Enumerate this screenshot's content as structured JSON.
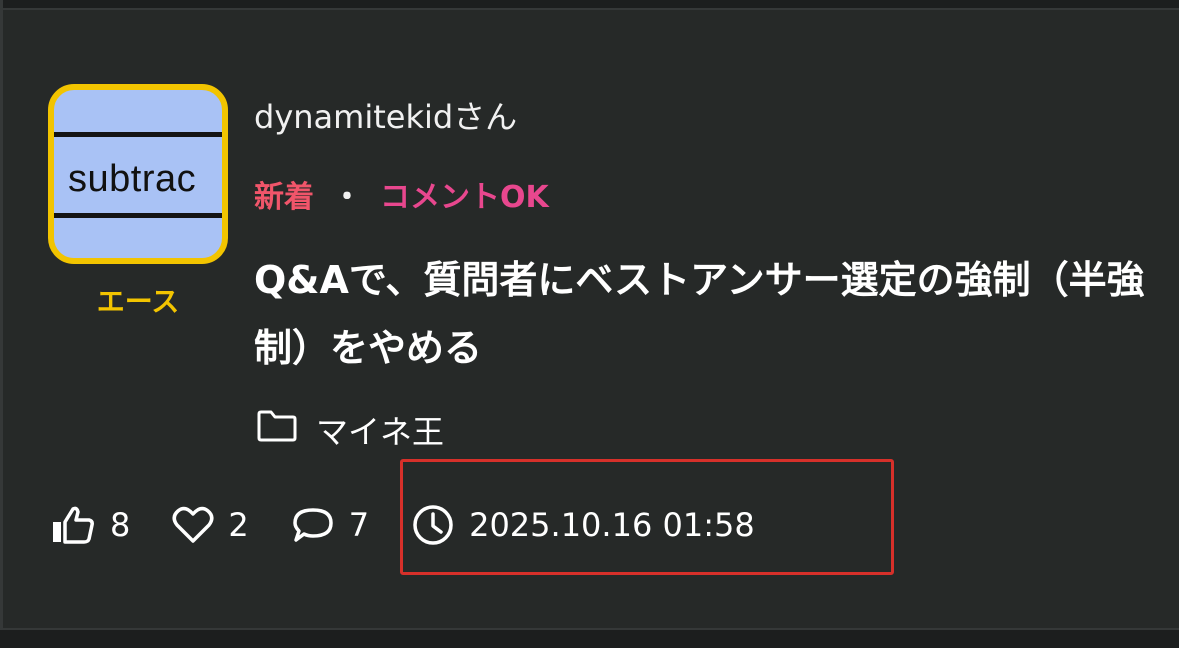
{
  "user": {
    "avatar_text": "subtrac",
    "rank": "エース",
    "name": "dynamitekidさん"
  },
  "tags": {
    "new": "新着",
    "separator": "・",
    "comment": "コメントOK"
  },
  "post": {
    "title": "Q&Aで、質問者にベストアンサー選定の強制（半強制）をやめる"
  },
  "category": {
    "icon": "folder-icon",
    "label": "マイネ王"
  },
  "stats": {
    "likes": "8",
    "favorites": "2",
    "comments": "7",
    "timestamp": "2025.10.16 01:58"
  },
  "colors": {
    "background": "#262928",
    "rank": "#f2c400",
    "tag_new": "#f0556a",
    "tag_comment": "#e8478e",
    "highlight": "#d6302a"
  }
}
